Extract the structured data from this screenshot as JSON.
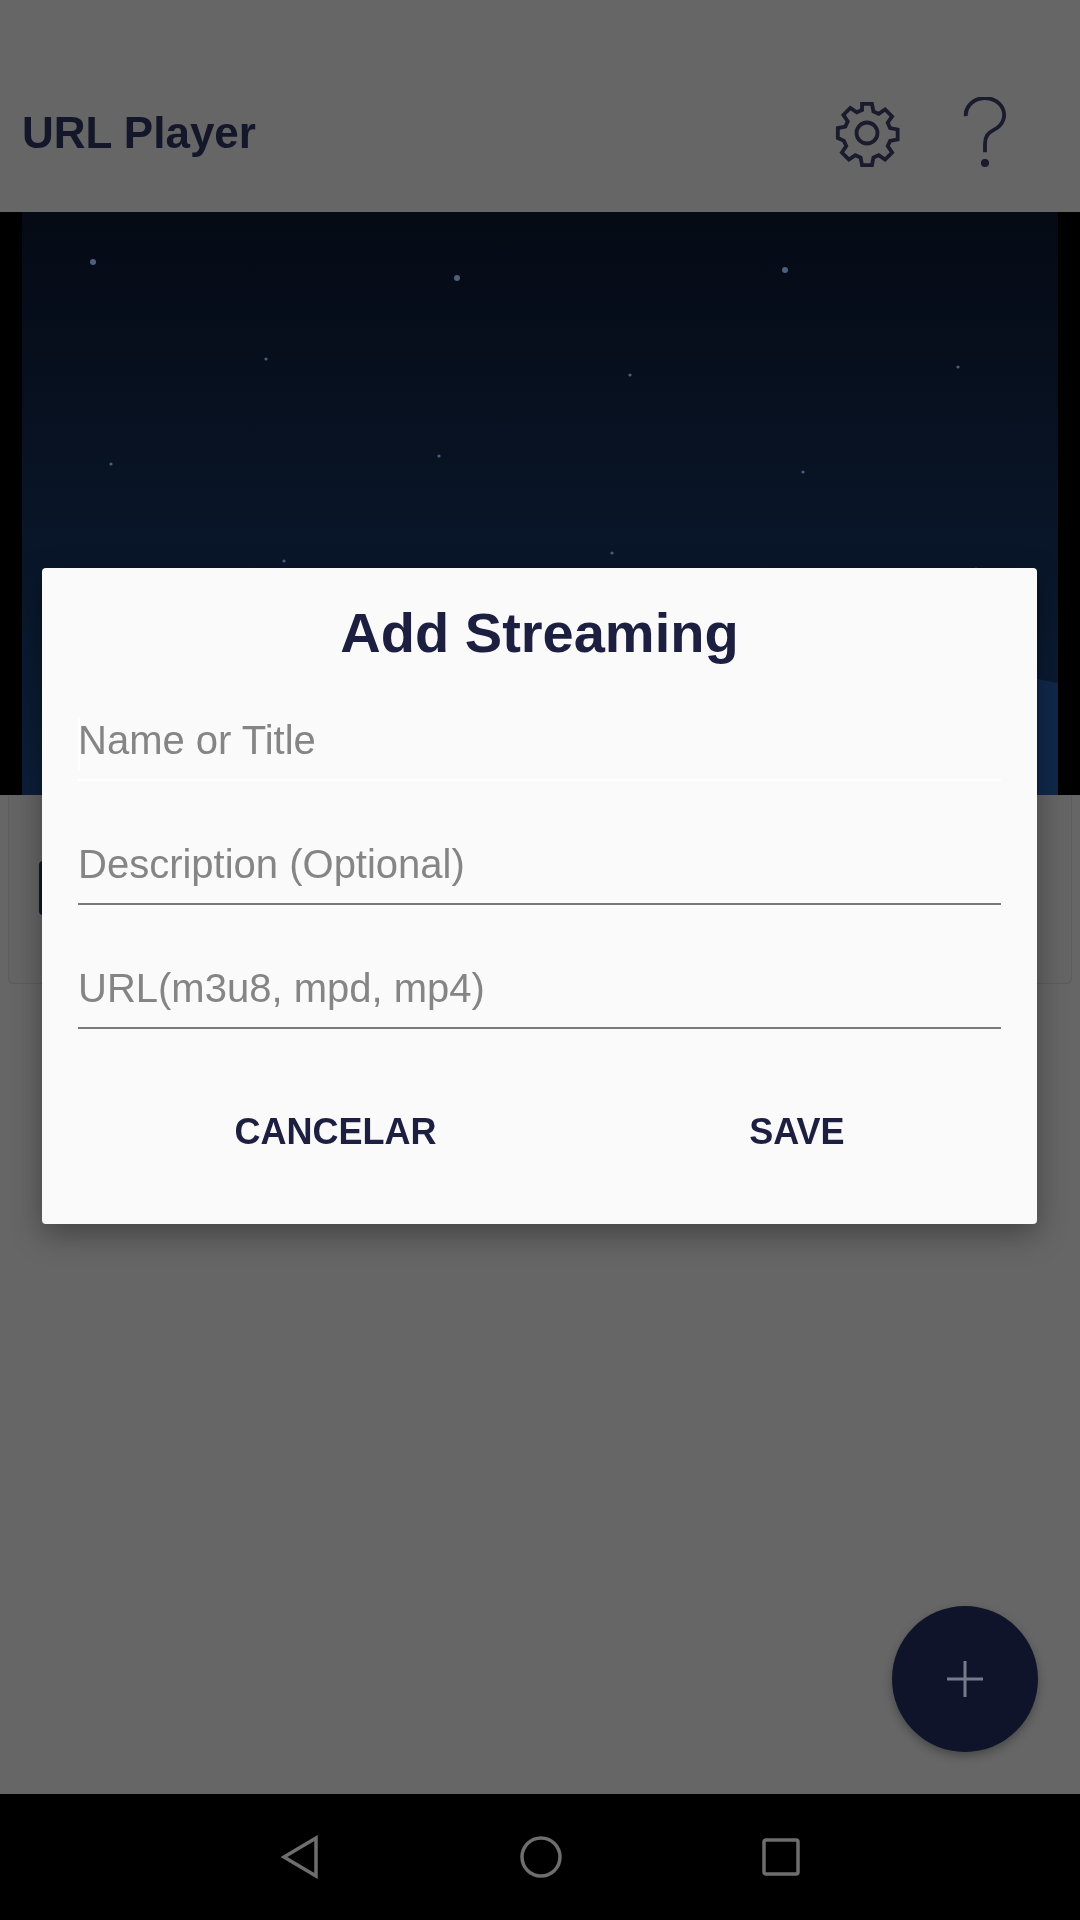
{
  "app_bar": {
    "title": "URL Player"
  },
  "dialog": {
    "title": "Add Streaming",
    "fields": [
      {
        "placeholder": "Name or Title",
        "focused": true
      },
      {
        "placeholder": "Description (Optional)",
        "focused": false
      },
      {
        "placeholder": "URL(m3u8, mpd, mp4)",
        "focused": false
      }
    ],
    "buttons": [
      "CANCELAR",
      "SAVE"
    ]
  }
}
